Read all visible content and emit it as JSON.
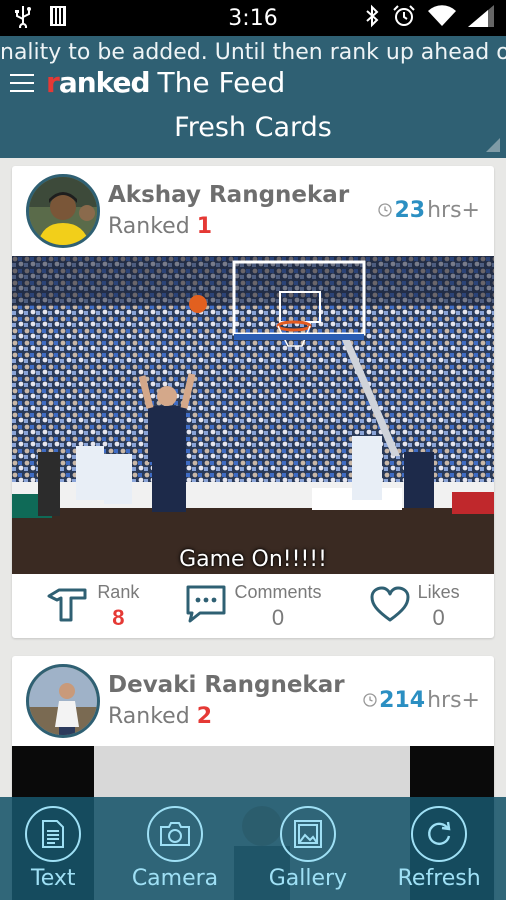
{
  "status_bar": {
    "time": "3:16",
    "left_icons": [
      "usb-icon",
      "sd-card-icon"
    ],
    "right_icons": [
      "bluetooth-icon",
      "alarm-icon",
      "wifi-icon",
      "signal-icon"
    ]
  },
  "header": {
    "ticker": "nality to be added. Until then rank up ahead of t",
    "logo": {
      "r": "r",
      "rest": "anked"
    },
    "title": "The Feed",
    "subtitle": "Fresh Cards"
  },
  "cards": [
    {
      "name": "Akshay Rangnekar",
      "ranked_label": "Ranked",
      "rank": "1",
      "hours": "23",
      "hours_suffix": "hrs+",
      "caption": "Game On!!!!!",
      "stats": {
        "rank_label": "Rank",
        "rank_value": "8",
        "comments_label": "Comments",
        "comments_value": "0",
        "likes_label": "Likes",
        "likes_value": "0"
      }
    },
    {
      "name": "Devaki Rangnekar",
      "ranked_label": "Ranked",
      "rank": "2",
      "hours": "214",
      "hours_suffix": "hrs+"
    }
  ],
  "bottom_bar": [
    {
      "label": "Text",
      "icon": "document-icon"
    },
    {
      "label": "Camera",
      "icon": "camera-icon"
    },
    {
      "label": "Gallery",
      "icon": "gallery-icon"
    },
    {
      "label": "Refresh",
      "icon": "refresh-icon"
    }
  ],
  "colors": {
    "header_bg": "#2f6073",
    "accent_blue": "#2b8fc2",
    "rank_red": "#e53935",
    "bottom_bar_bg": "#17546a",
    "bottom_bar_fg": "#9fe0f5"
  }
}
